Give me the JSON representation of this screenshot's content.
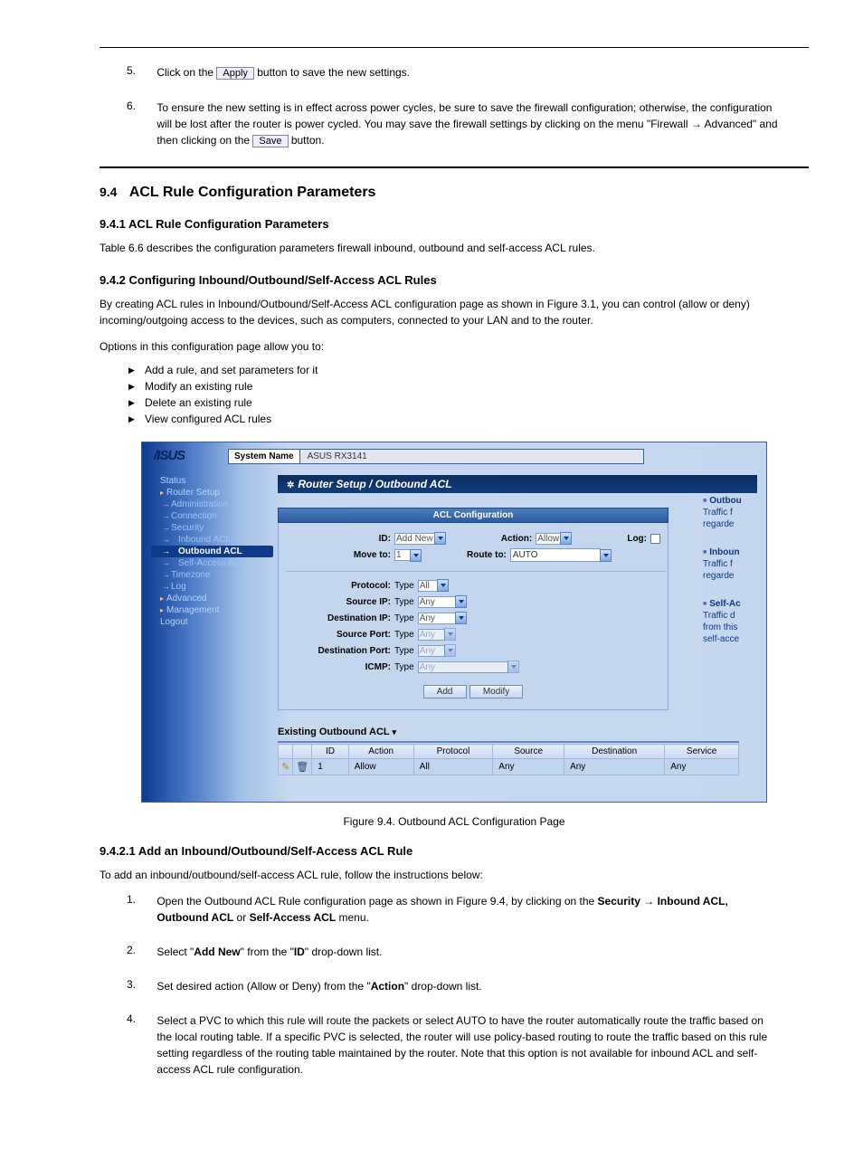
{
  "doc": {
    "step5_num": "5.",
    "step5_text_a": "Click on the ",
    "step5_btn": "Apply",
    "step5_text_b": " button to save the new settings.",
    "step6_num": "6.",
    "step6_text_a": "To ensure the new setting is in effect across power cycles, be sure to save the firewall configuration; otherwise, the configuration will be lost after the router is power cycled. You may save the firewall settings by clicking on the menu \"Firewall ",
    "step6_arrow": "→",
    "step6_text_b": " Advanced\" and then clicking on the ",
    "step6_btn": "Save",
    "step6_text_c": " button.",
    "sec_num": "9.4",
    "sec_title": "ACL Rule Configuration Parameters",
    "sub1": "9.4.1   ACL Rule Configuration Parameters",
    "para1": "Table 6.6 describes the configuration parameters firewall inbound, outbound and self-access ACL rules.",
    "sub2": "9.4.2   Configuring Inbound/Outbound/Self-Access ACL Rules",
    "para2": "By creating ACL rules in Inbound/Outbound/Self-Access ACL configuration page as shown in Figure 3.1, you can control (allow or deny) incoming/outgoing access to the devices, such as computers, connected to your LAN and to the router.",
    "para3": "Options in this configuration page allow you to:",
    "bullets": [
      "Add a rule, and set parameters for it",
      "Modify an existing rule",
      "Delete an existing rule",
      "View configured ACL rules"
    ],
    "fig_caption": "Figure 9.4. Outbound ACL Configuration Page",
    "sub3": "9.4.2.1   Add an Inbound/Outbound/Self-Access ACL Rule",
    "para4": "To add an inbound/outbound/self-access ACL rule, follow the instructions below:",
    "step1_num": "1.",
    "step1_text_a": "Open the Outbound ACL Rule configuration page as shown in Figure 9.4, by clicking on the ",
    "step1_bold_a": "Security",
    "step1_arrow": " → ",
    "step1_bold_b": "Inbound ACL, Outbound ACL",
    "step1_text_b": " or ",
    "step1_bold_c": "Self-Access ACL",
    "step1_text_c": " menu.",
    "step2_num": "2.",
    "step2_text_a": "Select \"",
    "step2_bold_a": "Add New",
    "step2_text_b": "\" from the \"",
    "step2_bold_b": "ID",
    "step2_text_c": "\" drop-down list.",
    "step3_num": "3.",
    "step3_text_a": "Set desired action (Allow or Deny) from the \"",
    "step3_bold_a": "Action",
    "step3_text_b": "\" drop-down list.",
    "step4_num": "4.",
    "step4_text": "Select a PVC to which this rule will route the packets or select AUTO to have the router automatically route the traffic based on the local routing table. If a specific PVC is selected, the router will use policy-based routing to route the traffic based on this rule setting regardless of the routing table maintained by the router. Note that this option is not available for inbound ACL and self-access ACL rule configuration."
  },
  "ss": {
    "sysname_label": "System Name",
    "sysname_value": "ASUS RX3141",
    "sidebar": {
      "status": "Status",
      "router_setup": "Router Setup",
      "administration": "Administration",
      "connection": "Connection",
      "security": "Security",
      "inbound_acl": "Inbound ACL",
      "outbound_acl": "Outbound ACL",
      "self_access_acl": "Self-Access ACL",
      "timezone": "Timezone",
      "log": "Log",
      "advanced": "Advanced",
      "management": "Management",
      "logout": "Logout"
    },
    "title": "Router Setup / Outbound ACL",
    "panel_hdr": "ACL Configuration",
    "labels": {
      "id": "ID:",
      "action": "Action:",
      "log": "Log:",
      "move_to": "Move to:",
      "route_to": "Route to:",
      "protocol": "Protocol:",
      "source_ip": "Source IP:",
      "dest_ip": "Destination IP:",
      "source_port": "Source Port:",
      "dest_port": "Destination Port:",
      "icmp": "ICMP:",
      "type": "Type"
    },
    "values": {
      "id": "Add New",
      "action": "Allow",
      "move_to": "1",
      "route_to": "AUTO",
      "protocol": "All",
      "source_ip": "Any",
      "dest_ip": "Any",
      "source_port": "Any",
      "dest_port": "Any",
      "icmp": "Any"
    },
    "buttons": {
      "add": "Add",
      "modify": "Modify"
    },
    "existing_hdr": "Existing Outbound ACL",
    "table": {
      "headers": [
        "ID",
        "Action",
        "Protocol",
        "Source",
        "Destination",
        "Service"
      ],
      "row": {
        "id": "1",
        "action": "Allow",
        "protocol": "All",
        "source": "Any",
        "destination": "Any",
        "service": "Any"
      }
    },
    "help": {
      "outbound_h": "Outbou",
      "outbound_t1": "Traffic f",
      "outbound_t2": "regarde",
      "inbound_h": "Inboun",
      "inbound_t1": "Traffic f",
      "inbound_t2": "regarde",
      "self_h": "Self-Ac",
      "self_t1": "Traffic d",
      "self_t2": "from this",
      "self_t3": "self-acce"
    }
  }
}
